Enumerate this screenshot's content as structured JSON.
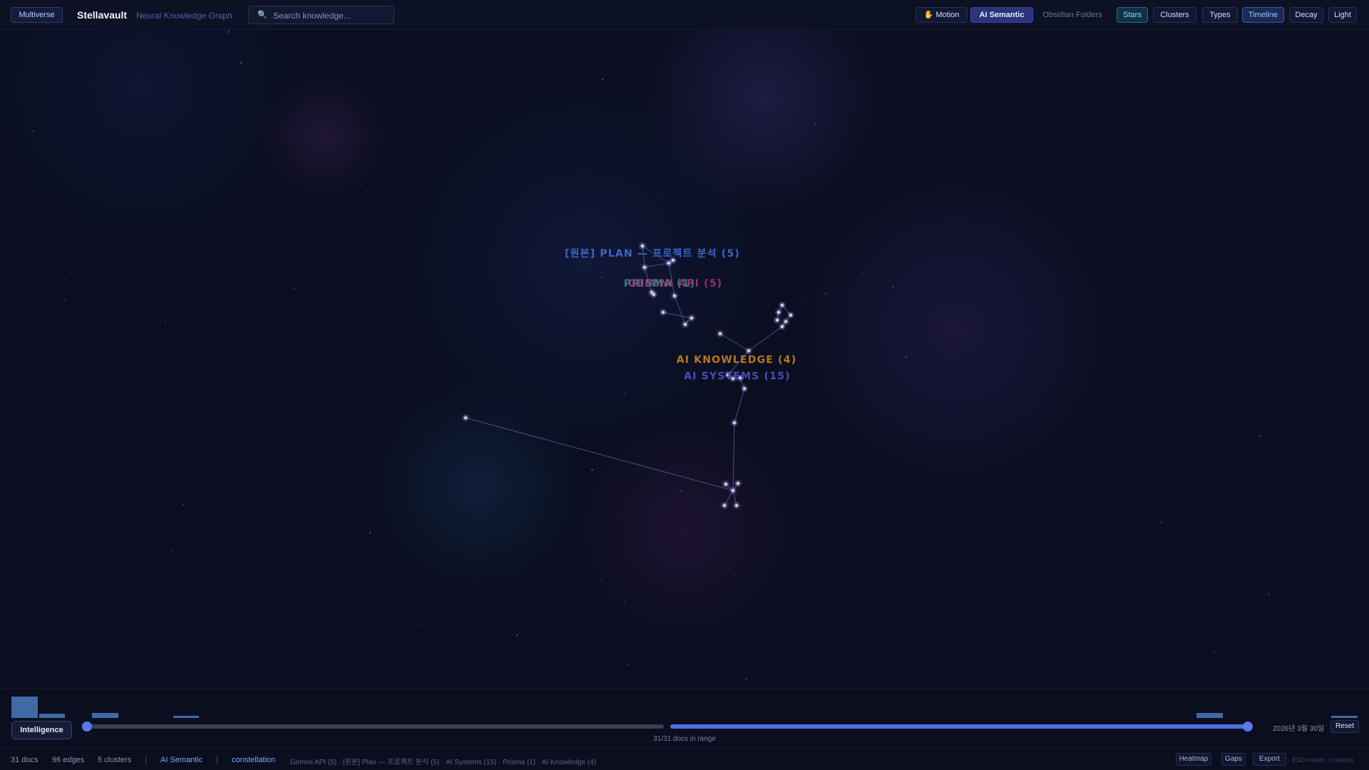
{
  "header": {
    "multiverse_label": "Multiverse",
    "brand": "Stellavault",
    "tagline": "Neural Knowledge Graph",
    "search_placeholder": "Search knowledge...",
    "buttons": {
      "motion": "Motion",
      "ai_semantic": "AI Semantic",
      "obsidian_folders": "Obsidian Folders",
      "stars": "Stars",
      "clusters": "Clusters",
      "types": "Types",
      "timeline": "Timeline",
      "decay": "Decay",
      "light": "Light"
    },
    "active_mode": "AI Semantic",
    "active_view": "Stars"
  },
  "graph": {
    "cluster_labels": [
      {
        "text": "[원본] PLAN — 프로젝트 분석 (5)",
        "color": "#3f6fd8"
      },
      {
        "text": "PRISMA (1)",
        "color": "#1f9d8a"
      },
      {
        "text": "GEMINI API (5)",
        "color": "#c0357a"
      },
      {
        "text": "AI KNOWLEDGE (4)",
        "color": "#c8841a"
      },
      {
        "text": "AI SYSTEMS (15)",
        "color": "#4b55c8"
      }
    ],
    "colors": {
      "edge": "#5a64a8",
      "node": "#e6ddff"
    }
  },
  "timeline": {
    "intelligence_label": "Intelligence",
    "range_text": "31/31 docs in range",
    "date": "2026년 3월 30일",
    "reset_label": "Reset",
    "range_fraction": [
      0.0,
      1.0
    ]
  },
  "status": {
    "docs": "31 docs",
    "edges": "96 edges",
    "clusters": "5 clusters",
    "separator": "|",
    "mode": "AI Semantic",
    "layout": "constellation",
    "summary": "Gemini API (5) · [원본] Plan — 프로젝트 분석 (5) · AI Systems (15) · Prisma (1) · AI Knowledge (4)",
    "heatmap": "Heatmap",
    "gaps": "Gaps",
    "export": "Export",
    "hint": "ESC=reset · /=search"
  }
}
